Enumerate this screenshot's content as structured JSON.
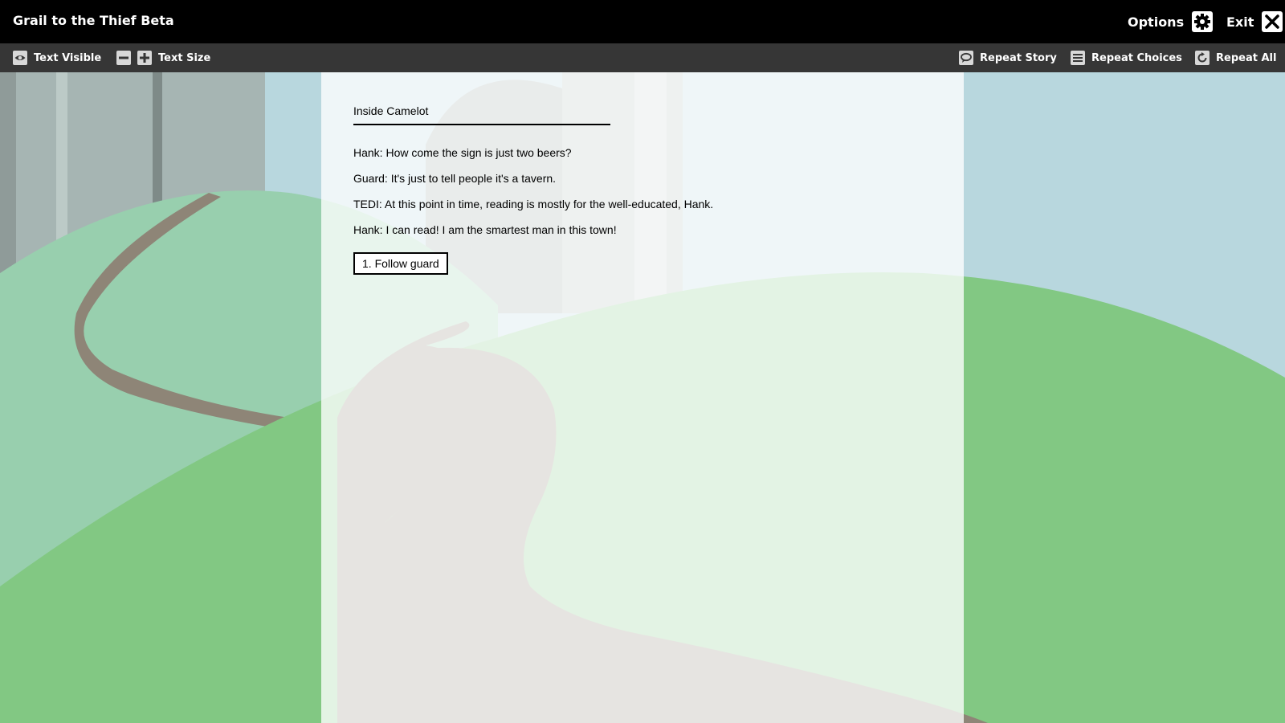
{
  "app": {
    "title": "Grail to the Thief Beta"
  },
  "titlebar": {
    "options_label": "Options",
    "options_icon": "gear-icon",
    "exit_label": "Exit",
    "exit_icon": "close-icon"
  },
  "toolbar": {
    "text_visible_label": "Text Visible",
    "text_visible_icon": "eye-icon",
    "text_size_label": "Text Size",
    "text_size_decrease_icon": "minus-icon",
    "text_size_increase_icon": "plus-icon",
    "repeat_story_label": "Repeat Story",
    "repeat_story_icon": "speech-icon",
    "repeat_choices_label": "Repeat Choices",
    "repeat_choices_icon": "list-icon",
    "repeat_all_label": "Repeat All",
    "repeat_all_icon": "refresh-icon"
  },
  "story": {
    "location": "Inside Camelot",
    "lines": [
      "Hank: How come the sign is just two beers?",
      "Guard: It's just to tell people it's a tavern.",
      "TEDI: At this point in time, reading is mostly for the well-educated, Hank.",
      "Hank: I can read! I am the smartest man in this town!"
    ],
    "choices": [
      "1. Follow guard"
    ]
  },
  "colors": {
    "sky": "#b8d7de",
    "hill_green": "#82c883",
    "path_gray": "#8e8577",
    "toolbar_bg": "#363636",
    "titlebar_bg": "#000000"
  }
}
